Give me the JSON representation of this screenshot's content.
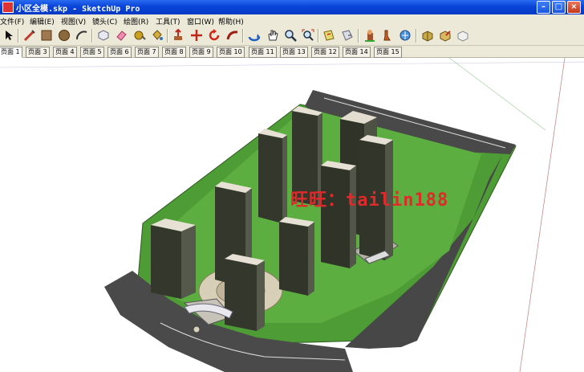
{
  "window": {
    "title": "小区全模.skp - SketchUp Pro"
  },
  "menu": [
    "文件(F)",
    "编辑(E)",
    "视图(V)",
    "镜头(C)",
    "绘图(R)",
    "工具(T)",
    "窗口(W)",
    "帮助(H)"
  ],
  "toolbar": {
    "tools": [
      "select-icon",
      "line-icon",
      "rectangle-icon",
      "circle-icon",
      "arc-icon",
      "make-component-icon",
      "eraser-icon",
      "tape-measure-icon",
      "paint-bucket-icon",
      "push-pull-icon",
      "move-icon",
      "rotate-icon",
      "follow-me-icon",
      "orbit-icon",
      "pan-icon",
      "zoom-icon",
      "zoom-extents-icon",
      "section-plane-icon",
      "previous-view-icon",
      "position-camera-icon",
      "walk-icon",
      "look-around-icon",
      "add-location-icon",
      "get-models-icon",
      "share-model-icon"
    ]
  },
  "scenes": [
    "页面 1",
    "页面 3",
    "页面 4",
    "页面 5",
    "页面 6",
    "页面 7",
    "页面 8",
    "页面 9",
    "页面 10",
    "页面 11",
    "页面 13",
    "页面 12",
    "页面 14",
    "页面 15"
  ],
  "active_scene": "页面 1",
  "watermark": "旺旺：tailin188",
  "colors": {
    "titlebar": "#0a44d8",
    "chrome": "#ece9d8",
    "lawn": "#59a83f",
    "road": "#4c4c4c",
    "building": "#3c4032",
    "watermark": "#e02a2a"
  }
}
